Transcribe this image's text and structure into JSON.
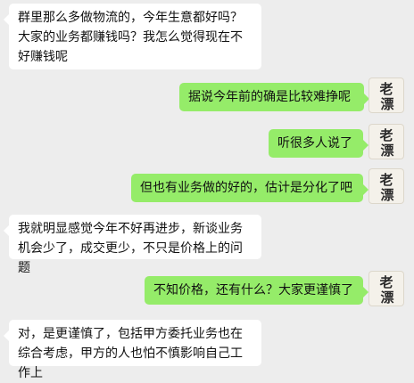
{
  "messages": [
    {
      "side": "left",
      "text": "群里那么多做物流的，今年生意都好吗？大家的业务都赚钱吗？我怎么觉得现在不好赚钱呢"
    },
    {
      "side": "right",
      "text": "据说今年前的确是比较难挣呢",
      "avatar_text": "老漂"
    },
    {
      "side": "right",
      "text": "听很多人说了",
      "avatar_text": "老漂"
    },
    {
      "side": "right",
      "text": "但也有业务做的好的，估计是分化了吧",
      "avatar_text": "老漂"
    },
    {
      "side": "left",
      "text": "我就明显感觉今年不好再进步，新谈业务机会少了，成交更少，不只是价格上的问题"
    },
    {
      "side": "right",
      "text": "不知价格，还有什么？大家更谨慎了",
      "avatar_text": "老漂"
    },
    {
      "side": "left",
      "text": "对，是更谨慎了，包括甲方委托业务也在综合考虑，甲方的人也怕不慎影响自己工作上"
    }
  ],
  "colors": {
    "background": "#ededed",
    "incoming_bubble": "#ffffff",
    "outgoing_bubble": "#95ec69",
    "avatar_ink": "#2a2a2a"
  },
  "icons": {
    "avatar": "calligraphy-avatar-icon"
  }
}
